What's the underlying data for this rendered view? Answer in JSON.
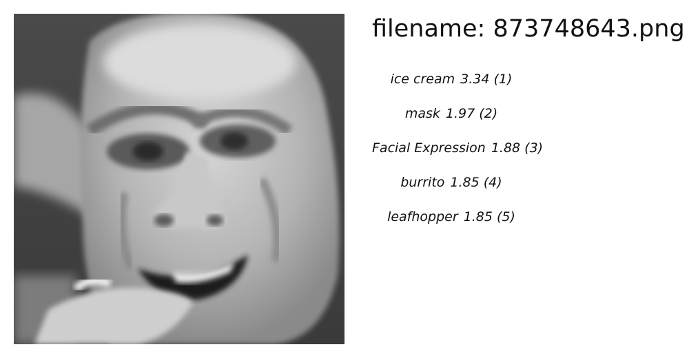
{
  "image": {
    "subject": "face-photo"
  },
  "filename": {
    "prefix": "filename:",
    "value": "873748643.png"
  },
  "predictions": [
    {
      "label": "ice cream",
      "score": "3.34",
      "rank": "(1)"
    },
    {
      "label": "mask",
      "score": "1.97",
      "rank": "(2)"
    },
    {
      "label": "Facial Expression",
      "score": "1.88",
      "rank": "(3)"
    },
    {
      "label": "burrito",
      "score": "1.85",
      "rank": "(4)"
    },
    {
      "label": "leafhopper",
      "score": "1.85",
      "rank": "(5)"
    }
  ]
}
